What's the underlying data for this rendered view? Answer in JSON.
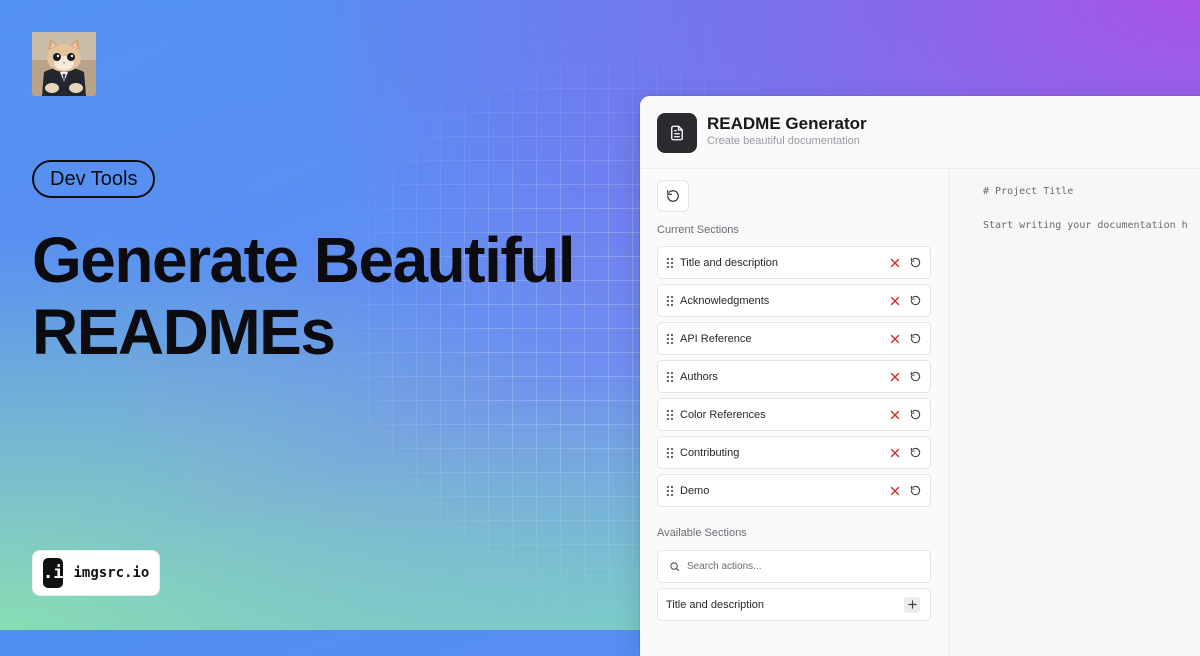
{
  "hero": {
    "tag": "Dev Tools",
    "headline_line1": "Generate Beautiful",
    "headline_line2": "READMEs",
    "brand_logo_text": ".i",
    "brand_name": "imgsrc.io"
  },
  "app": {
    "title": "README Generator",
    "subtitle": "Create beautiful documentation",
    "icon": "document-icon"
  },
  "sidebar": {
    "current_label": "Current Sections",
    "current_sections": [
      {
        "label": "Title and description"
      },
      {
        "label": "Acknowledgments"
      },
      {
        "label": "API Reference"
      },
      {
        "label": "Authors"
      },
      {
        "label": "Color References"
      },
      {
        "label": "Contributing"
      },
      {
        "label": "Demo"
      }
    ],
    "available_label": "Available Sections",
    "search_placeholder": "Search actions...",
    "available_sections": [
      {
        "label": "Title and description"
      }
    ]
  },
  "editor": {
    "line1": "# Project Title",
    "line2": "Start writing your documentation h"
  },
  "colors": {
    "delete_icon": "#dc2626",
    "app_icon_bg": "#2b2b2f"
  }
}
